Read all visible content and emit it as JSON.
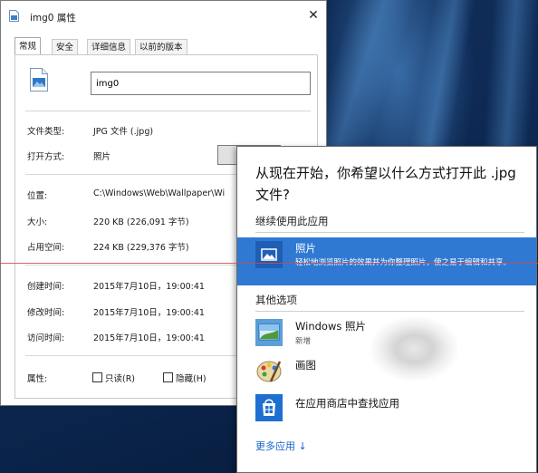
{
  "properties": {
    "title": "img0 属性",
    "tabs": [
      "常规",
      "安全",
      "详细信息",
      "以前的版本"
    ],
    "active_tab": "常规",
    "file_name": "img0",
    "file_type_label": "文件类型:",
    "file_type_value": "JPG 文件 (.jpg)",
    "open_with_label": "打开方式:",
    "open_with_value": "照片",
    "location_label": "位置:",
    "location_value": "C:\\Windows\\Web\\Wallpaper\\Wi",
    "size_label": "大小:",
    "size_value": "220 KB (226,091 字节)",
    "disk_size_label": "占用空间:",
    "disk_size_value": "224 KB (229,376 字节)",
    "created_label": "创建时间:",
    "created_value": "2015年7月10日，19:00:41",
    "modified_label": "修改时间:",
    "modified_value": "2015年7月10日，19:00:41",
    "accessed_label": "访问时间:",
    "accessed_value": "2015年7月10日，19:00:41",
    "attributes_label": "属性:",
    "readonly_label": "只读(R)",
    "hidden_label": "隐藏(H)"
  },
  "open_with": {
    "question": "从现在开始，你希望以什么方式打开此 .jpg 文件?",
    "keep_using_heading": "继续使用此应用",
    "current_app": {
      "name": "照片",
      "description": "轻松地浏览照片的效果并为你整理照片，使之易于编辑和共享。",
      "icon": "photos-icon"
    },
    "other_options_heading": "其他选项",
    "other_apps": [
      {
        "name": "Windows 照片",
        "sub": "新增",
        "icon": "windows-photo-viewer-icon"
      },
      {
        "name": "画图",
        "sub": "",
        "icon": "paint-icon"
      },
      {
        "name": "在应用商店中查找应用",
        "sub": "",
        "icon": "store-icon"
      }
    ],
    "more_apps_label": "更多应用 ↓"
  },
  "colors": {
    "accent": "#3079d3",
    "link": "#1664c8",
    "desktop": "#0e2a55"
  }
}
